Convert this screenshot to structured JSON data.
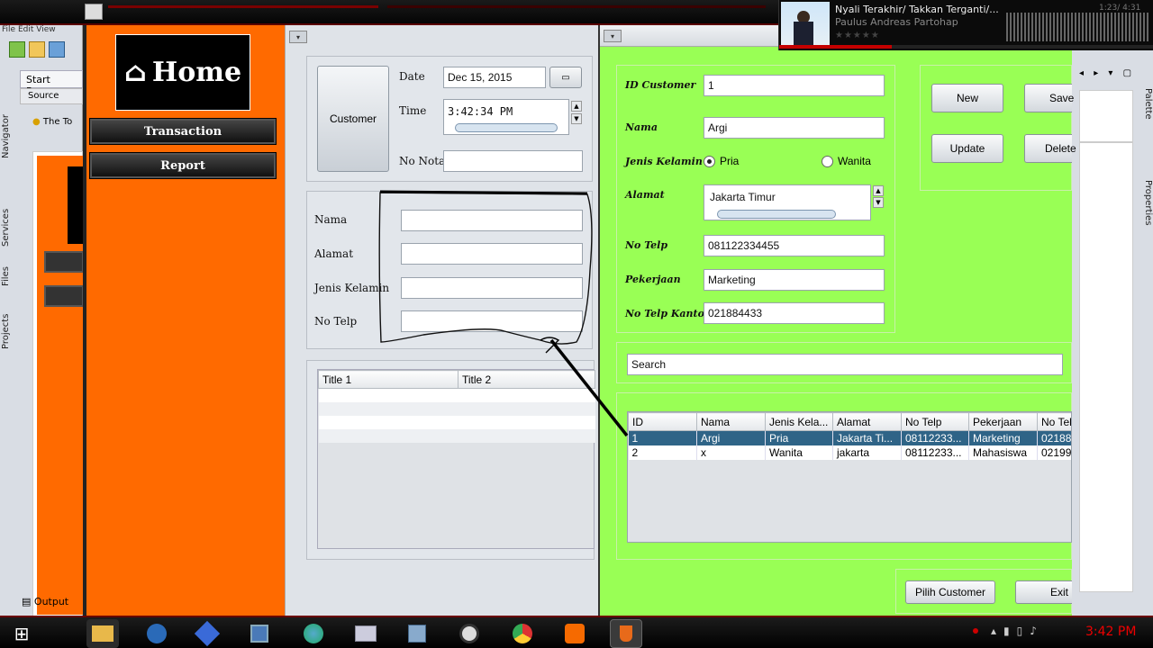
{
  "ide": {
    "menu": [
      "File",
      "Edit",
      "View"
    ],
    "start_page_tab": "Start Page",
    "source_tab": "Source",
    "tip_text": "The To",
    "side_tabs": [
      "Navigator",
      "Services",
      "Files",
      "Projects"
    ],
    "right_tabs": [
      "Palette",
      "Properties"
    ],
    "output_tab": "Output"
  },
  "home_window": {
    "home_title": "Home",
    "transaction_button": "Transaction",
    "report_button": "Report"
  },
  "transaction_form": {
    "customer_button": "Customer",
    "date_label": "Date",
    "date_value": "Dec 15, 2015",
    "time_label": "Time",
    "time_value": "3:42:34 PM",
    "no_nota_label": "No Nota",
    "no_nota_value": "",
    "nama_label": "Nama",
    "alamat_label": "Alamat",
    "jenis_kelamin_label": "Jenis Kelamin",
    "no_telp_label": "No Telp",
    "table_headers": [
      "Title 1",
      "Title 2"
    ]
  },
  "customer_form": {
    "id_label": "ID Customer",
    "id_value": "1",
    "nama_label": "Nama",
    "nama_value": "Argi",
    "jk_label": "Jenis Kelamin",
    "jk_option_pria": "Pria",
    "jk_option_wanita": "Wanita",
    "alamat_label": "Alamat",
    "alamat_value": "Jakarta Timur",
    "telp_label": "No Telp",
    "telp_value": "081122334455",
    "pekerjaan_label": "Pekerjaan",
    "pekerjaan_value": "Marketing",
    "telp_kantor_label": "No Telp Kantor",
    "telp_kantor_value": "021884433",
    "buttons": {
      "new": "New",
      "save": "Save",
      "update": "Update",
      "delete": "Delete",
      "pilih": "Pilih Customer",
      "exit": "Exit"
    },
    "search_value": "Search",
    "table": {
      "headers": [
        "ID",
        "Nama",
        "Jenis Kela...",
        "Alamat",
        "No Telp",
        "Pekerjaan",
        "No Tel"
      ],
      "rows": [
        [
          "1",
          "Argi",
          "Pria",
          "Jakarta Ti...",
          "08112233...",
          "Marketing",
          "02188"
        ],
        [
          "2",
          "x",
          "Wanita",
          "jakarta",
          "08112233...",
          "Mahasiswa",
          "02199"
        ]
      ]
    }
  },
  "media_player": {
    "title": "Nyali Terakhir/ Takkan Terganti/...",
    "artist": "Paulus Andreas Partohap",
    "time": "1:23/ 4:31"
  },
  "taskbar": {
    "clock": "3:42 PM",
    "icons": [
      "windows-start",
      "file-explorer",
      "thunderbird",
      "network-tool",
      "virtualbox",
      "globe-app",
      "image-viewer",
      "box-app",
      "cd-app",
      "chrome",
      "xampp",
      "java"
    ]
  }
}
